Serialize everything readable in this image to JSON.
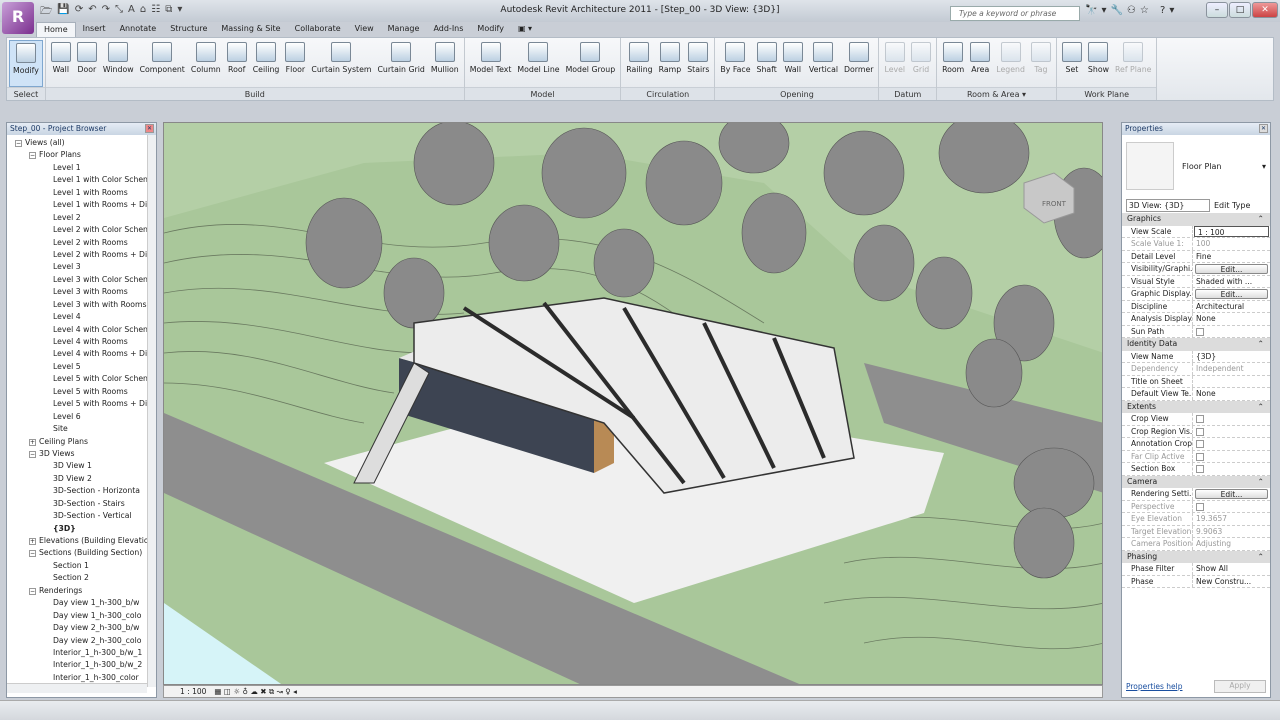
{
  "app": {
    "logo": "R",
    "title": "Autodesk Revit Architecture 2011 - [Step_00 - 3D View: {3D}]",
    "search_placeholder": "Type a keyword or phrase",
    "help_icons": "🔭▾🔧⚇☆ ?▾"
  },
  "tabs": [
    "Home",
    "Insert",
    "Annotate",
    "Structure",
    "Massing & Site",
    "Collaborate",
    "View",
    "Manage",
    "Add-Ins",
    "Modify",
    "▣ ▾"
  ],
  "ribbon": [
    {
      "label": "Select",
      "buttons": [
        {
          "label": "Modify",
          "selected": true
        }
      ]
    },
    {
      "label": "Build",
      "buttons": [
        {
          "label": "Wall"
        },
        {
          "label": "Door"
        },
        {
          "label": "Window"
        },
        {
          "label": "Component"
        },
        {
          "label": "Column"
        },
        {
          "label": "Roof"
        },
        {
          "label": "Ceiling"
        },
        {
          "label": "Floor"
        },
        {
          "label": "Curtain System"
        },
        {
          "label": "Curtain Grid"
        },
        {
          "label": "Mullion"
        }
      ]
    },
    {
      "label": "Model",
      "buttons": [
        {
          "label": "Model Text"
        },
        {
          "label": "Model Line"
        },
        {
          "label": "Model Group"
        }
      ]
    },
    {
      "label": "Circulation",
      "buttons": [
        {
          "label": "Railing"
        },
        {
          "label": "Ramp"
        },
        {
          "label": "Stairs"
        }
      ]
    },
    {
      "label": "Opening",
      "buttons": [
        {
          "label": "By Face"
        },
        {
          "label": "Shaft"
        },
        {
          "label": "Wall"
        },
        {
          "label": "Vertical"
        },
        {
          "label": "Dormer"
        }
      ]
    },
    {
      "label": "Datum",
      "buttons": [
        {
          "label": "Level",
          "disabled": true
        },
        {
          "label": "Grid",
          "disabled": true
        }
      ]
    },
    {
      "label": "Room & Area ▾",
      "buttons": [
        {
          "label": "Room"
        },
        {
          "label": "Area"
        },
        {
          "label": "Legend",
          "disabled": true
        },
        {
          "label": "Tag",
          "disabled": true
        }
      ]
    },
    {
      "label": "Work Plane",
      "buttons": [
        {
          "label": "Set"
        },
        {
          "label": "Show"
        },
        {
          "label": "Ref Plane",
          "disabled": true
        }
      ]
    }
  ],
  "browser": {
    "title": "Step_00 - Project Browser",
    "items": [
      {
        "label": "Views (all)",
        "depth": 0,
        "toggle": "−"
      },
      {
        "label": "Floor Plans",
        "depth": 1,
        "toggle": "−"
      },
      {
        "label": "Level 1",
        "depth": 2
      },
      {
        "label": "Level 1 with Color Schen",
        "depth": 2
      },
      {
        "label": "Level 1 with Rooms",
        "depth": 2
      },
      {
        "label": "Level 1 with Rooms + Di",
        "depth": 2
      },
      {
        "label": "Level 2",
        "depth": 2
      },
      {
        "label": "Level 2 with Color Schen",
        "depth": 2
      },
      {
        "label": "Level 2 with Rooms",
        "depth": 2
      },
      {
        "label": "Level 2 with Rooms + Di",
        "depth": 2
      },
      {
        "label": "Level 3",
        "depth": 2
      },
      {
        "label": "Level 3 with Color Schen",
        "depth": 2
      },
      {
        "label": "Level 3 with Rooms",
        "depth": 2
      },
      {
        "label": "Level 3 with with Rooms",
        "depth": 2
      },
      {
        "label": "Level 4",
        "depth": 2
      },
      {
        "label": "Level 4 with Color Schen",
        "depth": 2
      },
      {
        "label": "Level 4 with Rooms",
        "depth": 2
      },
      {
        "label": "Level 4 with Rooms + Di",
        "depth": 2
      },
      {
        "label": "Level 5",
        "depth": 2
      },
      {
        "label": "Level 5 with Color Schen",
        "depth": 2
      },
      {
        "label": "Level 5 with Rooms",
        "depth": 2
      },
      {
        "label": "Level 5 with Rooms + Di",
        "depth": 2
      },
      {
        "label": "Level 6",
        "depth": 2
      },
      {
        "label": "Site",
        "depth": 2
      },
      {
        "label": "Ceiling Plans",
        "depth": 1,
        "toggle": "+"
      },
      {
        "label": "3D Views",
        "depth": 1,
        "toggle": "−"
      },
      {
        "label": "3D View 1",
        "depth": 2
      },
      {
        "label": "3D View 2",
        "depth": 2
      },
      {
        "label": "3D-Section - Horizonta",
        "depth": 2
      },
      {
        "label": "3D-Section - Stairs",
        "depth": 2
      },
      {
        "label": "3D-Section - Vertical",
        "depth": 2
      },
      {
        "label": "{3D}",
        "depth": 2,
        "bold": true
      },
      {
        "label": "Elevations (Building Elevatio",
        "depth": 1,
        "toggle": "+"
      },
      {
        "label": "Sections (Building Section)",
        "depth": 1,
        "toggle": "−"
      },
      {
        "label": "Section 1",
        "depth": 2
      },
      {
        "label": "Section 2",
        "depth": 2
      },
      {
        "label": "Renderings",
        "depth": 1,
        "toggle": "−"
      },
      {
        "label": "Day view 1_h-300_b/w",
        "depth": 2
      },
      {
        "label": "Day view 1_h-300_colo",
        "depth": 2
      },
      {
        "label": "Day view 2_h-300_b/w",
        "depth": 2
      },
      {
        "label": "Day view 2_h-300_colo",
        "depth": 2
      },
      {
        "label": "Interior_1_h-300_b/w_1",
        "depth": 2
      },
      {
        "label": "Interior_1_h-300_b/w_2",
        "depth": 2
      },
      {
        "label": "Interior_1_h-300_color",
        "depth": 2
      }
    ]
  },
  "viewcube": {
    "label": "FRONT"
  },
  "view_control": {
    "scale": "1 : 100",
    "icons": "▦ ◫ ☼ ♁ ☁ ✖ ⧉ ↝ ♀ ◂"
  },
  "properties": {
    "title": "Properties",
    "type_name": "Floor Plan",
    "instance": "3D View: {3D}",
    "edit_type": "Edit Type",
    "sections": [
      {
        "name": "Graphics",
        "rows": [
          [
            "View Scale",
            "1 : 100",
            "box"
          ],
          [
            "Scale Value    1:",
            "100",
            "dis"
          ],
          [
            "Detail Level",
            "Fine"
          ],
          [
            "Visibility/Graphi...",
            "Edit...",
            "btn"
          ],
          [
            "Visual Style",
            "Shaded with ..."
          ],
          [
            "Graphic Display...",
            "Edit...",
            "btn"
          ],
          [
            "Discipline",
            "Architectural"
          ],
          [
            "Analysis Display...",
            "None"
          ],
          [
            "Sun Path",
            "",
            "cb"
          ]
        ]
      },
      {
        "name": "Identity Data",
        "rows": [
          [
            "View Name",
            "{3D}"
          ],
          [
            "Dependency",
            "Independent",
            "dis"
          ],
          [
            "Title on Sheet",
            ""
          ],
          [
            "Default View Te...",
            "None"
          ]
        ]
      },
      {
        "name": "Extents",
        "rows": [
          [
            "Crop View",
            "",
            "cb"
          ],
          [
            "Crop Region Vis...",
            "",
            "cb"
          ],
          [
            "Annotation Crop",
            "",
            "cb"
          ],
          [
            "Far Clip Active",
            "",
            "cbdis"
          ],
          [
            "Section Box",
            "",
            "cb"
          ]
        ]
      },
      {
        "name": "Camera",
        "rows": [
          [
            "Rendering Setti...",
            "Edit...",
            "btn"
          ],
          [
            "Perspective",
            "",
            "cbdis"
          ],
          [
            "Eye Elevation",
            "19.3657",
            "dis"
          ],
          [
            "Target Elevation",
            "9.9063",
            "dis"
          ],
          [
            "Camera Position",
            "Adjusting",
            "dis"
          ]
        ]
      },
      {
        "name": "Phasing",
        "rows": [
          [
            "Phase Filter",
            "Show All"
          ],
          [
            "Phase",
            "New Constru..."
          ]
        ]
      }
    ],
    "help": "Properties help",
    "apply": "Apply"
  },
  "colors": {
    "terrain": "#a9c79a",
    "road": "#8e8e8e",
    "pad": "#f0f0f0",
    "trees": "#8a8a8a",
    "water": "#d6f4f8",
    "timber": "#b88a55"
  }
}
